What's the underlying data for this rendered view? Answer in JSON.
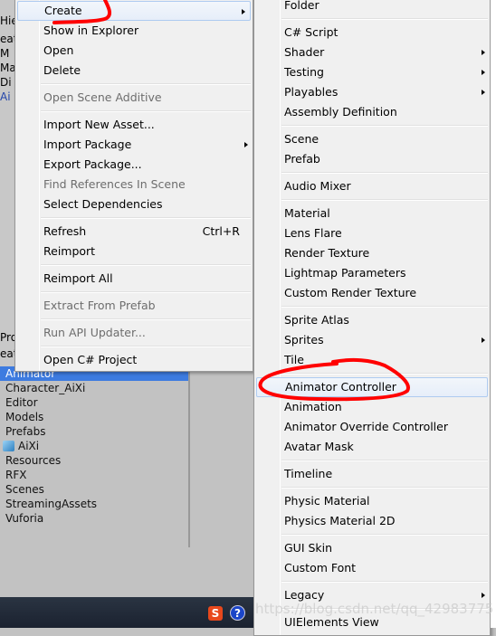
{
  "background_fragments": [
    "Hie",
    "eat",
    "M",
    "Ma",
    "Di",
    "Ai",
    "Pro",
    "eat"
  ],
  "project": {
    "folders": [
      {
        "label": "Animator",
        "selected": true
      },
      {
        "label": "Character_AiXi"
      },
      {
        "label": "Editor"
      },
      {
        "label": "Models"
      },
      {
        "label": "Prefabs"
      },
      {
        "label": "AiXi",
        "prefab": true
      },
      {
        "label": "Resources"
      },
      {
        "label": "RFX"
      },
      {
        "label": "Scenes"
      },
      {
        "label": "StreamingAssets"
      },
      {
        "label": "Vuforia"
      }
    ]
  },
  "taskbar": {
    "sogou": "S",
    "help": "?"
  },
  "context_menu": [
    {
      "label": "Create",
      "submenu": true,
      "highlighted": true
    },
    {
      "label": "Show in Explorer"
    },
    {
      "label": "Open"
    },
    {
      "label": "Delete"
    },
    {
      "sep": true
    },
    {
      "label": "Open Scene Additive",
      "disabled": true
    },
    {
      "sep": true
    },
    {
      "label": "Import New Asset..."
    },
    {
      "label": "Import Package",
      "submenu": true
    },
    {
      "label": "Export Package..."
    },
    {
      "label": "Find References In Scene",
      "disabled": true
    },
    {
      "label": "Select Dependencies"
    },
    {
      "sep": true
    },
    {
      "label": "Refresh",
      "shortcut": "Ctrl+R"
    },
    {
      "label": "Reimport"
    },
    {
      "sep": true
    },
    {
      "label": "Reimport All"
    },
    {
      "sep": true
    },
    {
      "label": "Extract From Prefab",
      "disabled": true
    },
    {
      "sep": true
    },
    {
      "label": "Run API Updater...",
      "disabled": true
    },
    {
      "sep": true
    },
    {
      "label": "Open C# Project"
    }
  ],
  "create_submenu": [
    {
      "label": "Folder"
    },
    {
      "sep": true
    },
    {
      "label": "C# Script"
    },
    {
      "label": "Shader",
      "submenu": true
    },
    {
      "label": "Testing",
      "submenu": true
    },
    {
      "label": "Playables",
      "submenu": true
    },
    {
      "label": "Assembly Definition"
    },
    {
      "sep": true
    },
    {
      "label": "Scene"
    },
    {
      "label": "Prefab"
    },
    {
      "sep": true
    },
    {
      "label": "Audio Mixer"
    },
    {
      "sep": true
    },
    {
      "label": "Material"
    },
    {
      "label": "Lens Flare"
    },
    {
      "label": "Render Texture"
    },
    {
      "label": "Lightmap Parameters"
    },
    {
      "label": "Custom Render Texture"
    },
    {
      "sep": true
    },
    {
      "label": "Sprite Atlas"
    },
    {
      "label": "Sprites",
      "submenu": true
    },
    {
      "label": "Tile"
    },
    {
      "sep": true
    },
    {
      "label": "Animator Controller",
      "highlighted": true
    },
    {
      "label": "Animation"
    },
    {
      "label": "Animator Override Controller"
    },
    {
      "label": "Avatar Mask"
    },
    {
      "sep": true
    },
    {
      "label": "Timeline"
    },
    {
      "sep": true
    },
    {
      "label": "Physic Material"
    },
    {
      "label": "Physics Material 2D"
    },
    {
      "sep": true
    },
    {
      "label": "GUI Skin"
    },
    {
      "label": "Custom Font"
    },
    {
      "sep": true
    },
    {
      "label": "Legacy",
      "submenu": true
    },
    {
      "sep": true
    },
    {
      "label": "UIElements View"
    }
  ],
  "watermark": "https://blog.csdn.net/qq_42983775",
  "annotation_color": "#ff0000"
}
